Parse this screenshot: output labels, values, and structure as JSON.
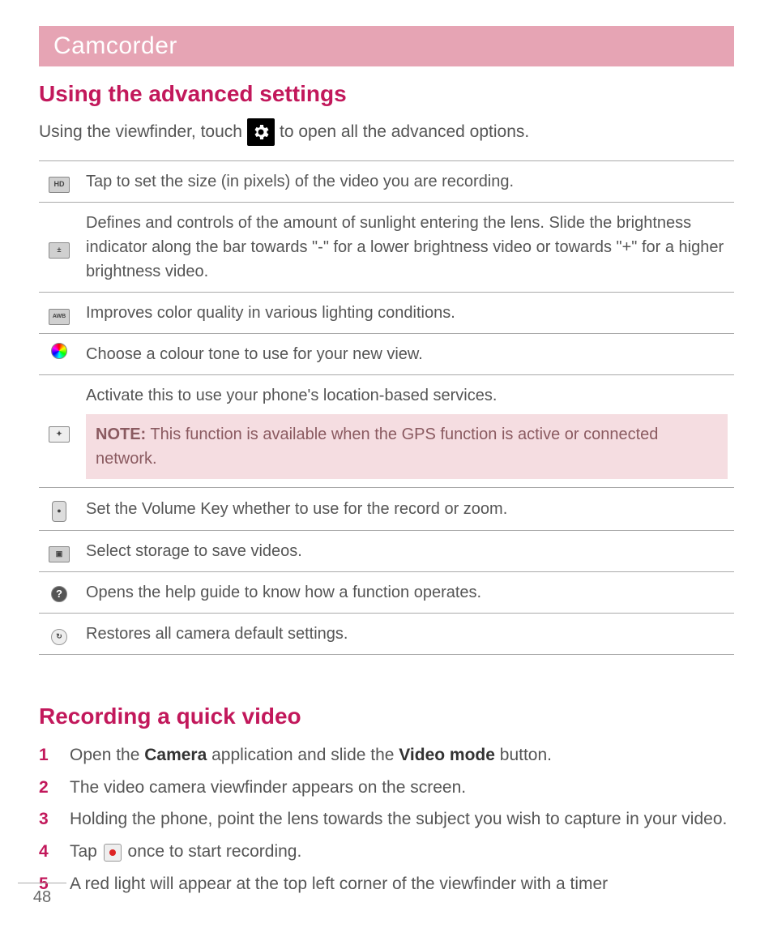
{
  "chapter": "Camcorder",
  "section1": {
    "heading": "Using the advanced settings",
    "intro_pre": "Using the viewfinder, touch",
    "intro_post": "to open all the advanced options."
  },
  "rows": [
    {
      "icon_label": "HD",
      "icon_class": "mini-icon",
      "text": "Tap to set the size (in pixels) of the video you are recording."
    },
    {
      "icon_label": "±",
      "icon_class": "mini-icon",
      "text": "Defines and controls of the amount of sunlight entering the lens. Slide the brightness indicator along the bar towards \"-\" for a lower brightness video or towards \"+\" for a higher brightness video."
    },
    {
      "icon_label": "AWB",
      "icon_class": "mini-icon awb",
      "text": "Improves color quality in various lighting conditions."
    },
    {
      "icon_label": "",
      "icon_class": "mini-icon color",
      "text": "Choose a colour tone to use for your new view."
    },
    {
      "icon_label": "✦",
      "icon_class": "mini-icon geo",
      "text": "Activate this to use your phone's location-based services.",
      "note_label": "NOTE:",
      "note_body": " This function is available when the GPS function is active or connected network."
    },
    {
      "icon_label": "●",
      "icon_class": "mini-icon vol",
      "text": "Set the Volume Key whether to use for the record or zoom."
    },
    {
      "icon_label": "▣",
      "icon_class": "mini-icon store",
      "text": "Select storage to save videos."
    },
    {
      "icon_label": "?",
      "icon_class": "mini-icon help",
      "text": "Opens the help guide to know how a function operates."
    },
    {
      "icon_label": "↻",
      "icon_class": "mini-icon reset",
      "text": "Restores all camera default settings."
    }
  ],
  "section2": {
    "heading": "Recording a quick video",
    "steps": [
      {
        "pre": "Open the ",
        "b1": "Camera",
        "mid": " application and slide the ",
        "b2": "Video mode",
        "post": " button."
      },
      {
        "pre": "The video camera viewfinder appears on the screen."
      },
      {
        "pre": "Holding the phone, point the lens towards the subject you wish to capture in your video."
      },
      {
        "pre": "Tap ",
        "rec_icon": true,
        "post": " once to start recording."
      },
      {
        "pre": "A red light will appear at the top left corner of the viewfinder with a timer"
      }
    ]
  },
  "page_number": "48"
}
